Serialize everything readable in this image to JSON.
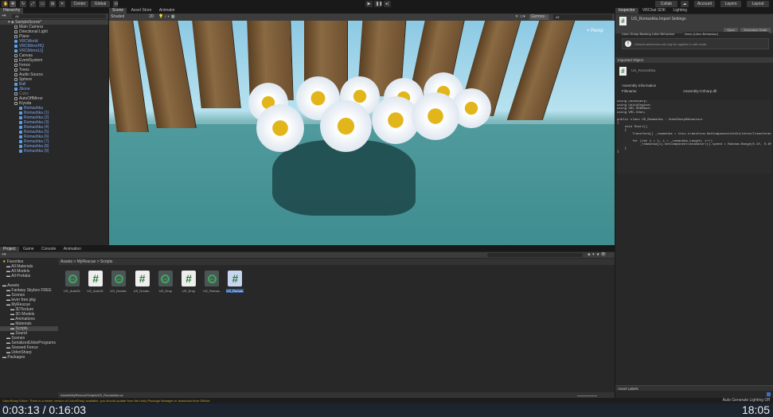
{
  "toolbar": {
    "tools": [
      "hand",
      "move",
      "rotate",
      "scale",
      "rect",
      "transform",
      "custom"
    ],
    "pivot": "Center",
    "space": "Global",
    "right": [
      "Collab",
      "cloud",
      "Account",
      "Layers",
      "Layout"
    ]
  },
  "hierarchy": {
    "title": "Hierarchy",
    "search": "All",
    "scene": "SampleScene*",
    "items": [
      {
        "label": "Main Camera",
        "depth": 1,
        "type": "n"
      },
      {
        "label": "Directional Light",
        "depth": 1,
        "type": "n"
      },
      {
        "label": "Plane",
        "depth": 1,
        "type": "n"
      },
      {
        "label": "VRCWorld",
        "depth": 1,
        "type": "b"
      },
      {
        "label": "VRCMirrorHQ",
        "depth": 1,
        "type": "b"
      },
      {
        "label": "VRCMirrorLQ",
        "depth": 1,
        "type": "b"
      },
      {
        "label": "Canvas",
        "depth": 1,
        "type": "n"
      },
      {
        "label": "EventSystem",
        "depth": 1,
        "type": "n"
      },
      {
        "label": "Fence",
        "depth": 1,
        "type": "n"
      },
      {
        "label": "Trees",
        "depth": 1,
        "type": "n"
      },
      {
        "label": "Audio Source",
        "depth": 1,
        "type": "n"
      },
      {
        "label": "Sphere",
        "depth": 1,
        "type": "n"
      },
      {
        "label": "Ball",
        "depth": 1,
        "type": "b"
      },
      {
        "label": "Jbone",
        "depth": 1,
        "type": "b"
      },
      {
        "label": "Cube",
        "depth": 1,
        "type": "d"
      },
      {
        "label": "AutoOffMirror",
        "depth": 1,
        "type": "n"
      },
      {
        "label": "Kiyoda",
        "depth": 1,
        "type": "n"
      },
      {
        "label": "Romashka",
        "depth": 2,
        "type": "b"
      },
      {
        "label": "Romashka (1)",
        "depth": 2,
        "type": "b"
      },
      {
        "label": "Romashka (2)",
        "depth": 2,
        "type": "b"
      },
      {
        "label": "Romashka (3)",
        "depth": 2,
        "type": "b"
      },
      {
        "label": "Romashka (4)",
        "depth": 2,
        "type": "b"
      },
      {
        "label": "Romashka (5)",
        "depth": 2,
        "type": "b"
      },
      {
        "label": "Romashka (6)",
        "depth": 2,
        "type": "b"
      },
      {
        "label": "Romashka (7)",
        "depth": 2,
        "type": "b"
      },
      {
        "label": "Romashka (8)",
        "depth": 2,
        "type": "b"
      },
      {
        "label": "Romashka (9)",
        "depth": 2,
        "type": "b"
      }
    ]
  },
  "scene": {
    "tabs": [
      "Scene",
      "Asset Store",
      "Animator"
    ],
    "shading": "Shaded",
    "mode2d": "2D",
    "gizmos": "Gizmos",
    "search": "All",
    "persp": "< Persp"
  },
  "inspector": {
    "tabs": [
      "Inspector",
      "VRChat SDK",
      "Lighting"
    ],
    "title": "US_Romashka Import Settings",
    "open": "Open",
    "exec_order": "Execution Order",
    "backing_label": "Udon Sharp Backing Udon Behaviour",
    "backing_value": "None (Udon Behaviour)",
    "info": "Default references will only be applied in edit mode.",
    "imported_object": "Imported Object",
    "imported_name": "US_Romashka",
    "assembly_info": "Assembly Information",
    "filename_label": "Filename",
    "filename_value": "Assembly-CSharp.dll",
    "code": "using UdonSharp;\nusing UnityEngine;\nusing VRC.SDKBase;\nusing VRC.Udon;\n\npublic class US_Romashka : UdonSharpBehaviour\n{\n    void Start()\n    {\n        Transform[] _romashka = this.transform.GetComponentsInChildren<Transform>();\n\n        for (int i = 1; i < _romashka.Length; i++)\n            _romashka[i].GetComponent<Animator>().speed = Random.Range(0.4f, 0.8f);\n    }\n}",
    "asset_labels": "Asset Labels",
    "auto_generate": "Auto Generate Lighting Off"
  },
  "project": {
    "tabs": [
      "Project",
      "Game",
      "Console",
      "Animation"
    ],
    "breadcrumb": [
      "Assets",
      "MyRescue",
      "Scripts"
    ],
    "tree": [
      {
        "label": "Favorites",
        "d": 0
      },
      {
        "label": "All Materials",
        "d": 1
      },
      {
        "label": "All Models",
        "d": 1
      },
      {
        "label": "All Prefabs",
        "d": 1
      },
      {
        "label": "",
        "d": 0
      },
      {
        "label": "Assets",
        "d": 0
      },
      {
        "label": "Fantasy Skybox FREE",
        "d": 1
      },
      {
        "label": "Scenes",
        "d": 1
      },
      {
        "label": "lever free pkg",
        "d": 1
      },
      {
        "label": "MyRescue",
        "d": 1
      },
      {
        "label": "3DTexture",
        "d": 2
      },
      {
        "label": "3D Models",
        "d": 2
      },
      {
        "label": "Animations",
        "d": 2
      },
      {
        "label": "Materials",
        "d": 2
      },
      {
        "label": "Scripts",
        "d": 2
      },
      {
        "label": "Sound",
        "d": 2
      },
      {
        "label": "Scenes",
        "d": 1
      },
      {
        "label": "SerializedUdonPrograms",
        "d": 1
      },
      {
        "label": "Snowed Fence",
        "d": 1
      },
      {
        "label": "UdonSharp",
        "d": 1
      },
      {
        "label": "Packages",
        "d": 0
      }
    ],
    "files": [
      {
        "label": "US_AutoOf...",
        "kind": "udon"
      },
      {
        "label": "US_AutoOf...",
        "kind": "cs"
      },
      {
        "label": "US_Dream...",
        "kind": "udon"
      },
      {
        "label": "US_Dream...",
        "kind": "cs"
      },
      {
        "label": "US_Drop",
        "kind": "udon"
      },
      {
        "label": "US_Drop",
        "kind": "cs"
      },
      {
        "label": "US_Romas...",
        "kind": "udon"
      },
      {
        "label": "US_Romas...",
        "kind": "cs"
      }
    ],
    "path": "Assets/MyRescue/Scripts/US_Romashka.cs"
  },
  "status": "UdonSharp Editor: There is a newer version of UdonSharp available, you should update from the Unity Package Manager or download from GitHub",
  "video": {
    "time": "0:03:13 / 0:16:03",
    "clock": "18:05"
  }
}
